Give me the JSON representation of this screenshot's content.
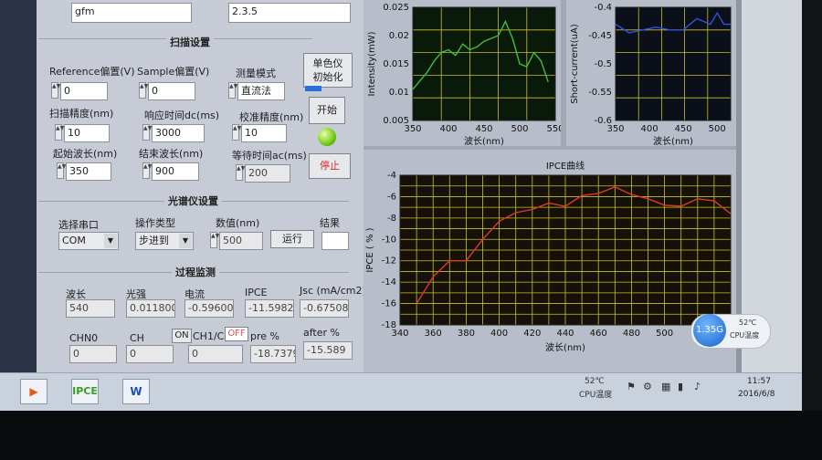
{
  "top_fields": {
    "left": "gfm",
    "right": "2.3.5"
  },
  "scan": {
    "title": "扫描设置",
    "ref_label": "Reference偏置(V)",
    "ref_value": "0",
    "sample_label": "Sample偏置(V)",
    "sample_value": "0",
    "mode_label": "测量模式",
    "mode_value": "直流法",
    "precision_label": "扫描精度(nm)",
    "precision_value": "10",
    "response_label": "响应时间dc(ms)",
    "response_value": "3000",
    "calib_label": "校准精度(nm)",
    "calib_value": "10",
    "start_label": "起始波长(nm)",
    "start_value": "350",
    "end_label": "结束波长(nm)",
    "end_value": "900",
    "wait_label": "等待时间ac(ms)",
    "wait_value": "200"
  },
  "buttons": {
    "init_line1": "单色仪",
    "init_line2": "初始化",
    "start": "开始",
    "stop": "停止"
  },
  "spectro": {
    "title": "光谱仪设置",
    "port_label": "选择串口",
    "port_value": "COM",
    "op_label": "操作类型",
    "op_value": "步进到",
    "num_label": "数值(nm)",
    "num_value": "500",
    "run": "运行",
    "result_label": "结果"
  },
  "monitor": {
    "title": "过程监测",
    "wl_label": "波长",
    "wl_value": "540",
    "light_label": "光强",
    "light_value": "0.011800",
    "cur_label": "电流",
    "cur_value": "-0.59600",
    "ipce_label": "IPCE",
    "ipce_value": "-11.5982",
    "jsc_label": "Jsc (mA/cm2)",
    "jsc_value": "-0.67508",
    "chn0_label": "CHN0",
    "chn0_value": "0",
    "ch_label": "CH",
    "ch_value": "0",
    "on": "ON",
    "ch1c_label": "CH1/C",
    "off": "OFF",
    "ch1c_value": "0",
    "pre_label": "pre %",
    "pre_value": "-18.7379",
    "after_label": "after %",
    "after_value": "-15.589"
  },
  "chart_data": [
    {
      "type": "line",
      "title": "",
      "xlabel": "波长(nm)",
      "ylabel": "Intensity(mW)",
      "xlim": [
        350,
        550
      ],
      "ylim": [
        0.005,
        0.025
      ],
      "x_ticks": [
        350,
        400,
        450,
        500,
        550
      ],
      "y_ticks": [
        "0.025",
        "0.02",
        "0.015",
        "0.01",
        "0.005"
      ],
      "color": "#3fbf3f",
      "background": "#0a1a0a",
      "series": [
        {
          "x": [
            350,
            360,
            370,
            380,
            390,
            400,
            410,
            420,
            430,
            440,
            450,
            460,
            470,
            480,
            490,
            500,
            510,
            520,
            530,
            540
          ],
          "y": [
            0.0105,
            0.012,
            0.0135,
            0.0155,
            0.017,
            0.0175,
            0.0165,
            0.0185,
            0.0175,
            0.018,
            0.019,
            0.0195,
            0.02,
            0.0225,
            0.0195,
            0.015,
            0.0145,
            0.017,
            0.0155,
            0.0118
          ]
        }
      ]
    },
    {
      "type": "line",
      "title": "",
      "xlabel": "波长(nm)",
      "ylabel": "Short-current(uA)",
      "xlim": [
        350,
        520
      ],
      "ylim": [
        -0.6,
        -0.4
      ],
      "x_ticks": [
        350,
        400,
        450,
        500
      ],
      "y_ticks": [
        "-0.4",
        "-0.45",
        "-0.5",
        "-0.55",
        "-0.6"
      ],
      "color": "#2b55e0",
      "background": "#0a0f1a",
      "series": [
        {
          "x": [
            350,
            370,
            390,
            410,
            430,
            450,
            470,
            490,
            500,
            510,
            520
          ],
          "y": [
            -0.43,
            -0.445,
            -0.44,
            -0.435,
            -0.44,
            -0.44,
            -0.42,
            -0.43,
            -0.41,
            -0.43,
            -0.43
          ]
        }
      ]
    },
    {
      "type": "line",
      "title": "IPCE曲线",
      "xlabel": "波长(nm)",
      "ylabel": "IPCE ( % )",
      "xlim": [
        340,
        540
      ],
      "ylim": [
        -18,
        -4
      ],
      "x_ticks": [
        340,
        360,
        380,
        400,
        420,
        440,
        460,
        480,
        500,
        520
      ],
      "x_tick_labels": [
        "340",
        "360",
        "380",
        "400",
        "420",
        "440",
        "460",
        "480",
        "500",
        "52"
      ],
      "y_ticks": [
        "-4",
        "-6",
        "-8",
        "-10",
        "-12",
        "-14",
        "-16",
        "-18"
      ],
      "color": "#e03a2a",
      "background": "#151008",
      "series": [
        {
          "x": [
            350,
            360,
            370,
            380,
            390,
            400,
            410,
            420,
            430,
            440,
            450,
            460,
            470,
            480,
            490,
            500,
            510,
            520,
            530,
            540
          ],
          "y": [
            -16,
            -13.5,
            -12,
            -12,
            -10,
            -8.3,
            -7.5,
            -7.2,
            -6.6,
            -6.9,
            -5.9,
            -5.7,
            -5.1,
            -5.8,
            -6.2,
            -6.8,
            -6.9,
            -6.2,
            -6.4,
            -7.6
          ]
        }
      ]
    }
  ],
  "overlay": {
    "badge": "1.35G",
    "temp": "52℃",
    "temp_label": "CPU温度"
  },
  "taskbar": {
    "temp": "52℃",
    "temp_label": "CPU温度",
    "time": "11:57",
    "date": "2016/6/8",
    "app1": "IPCE",
    "app2": "W"
  }
}
